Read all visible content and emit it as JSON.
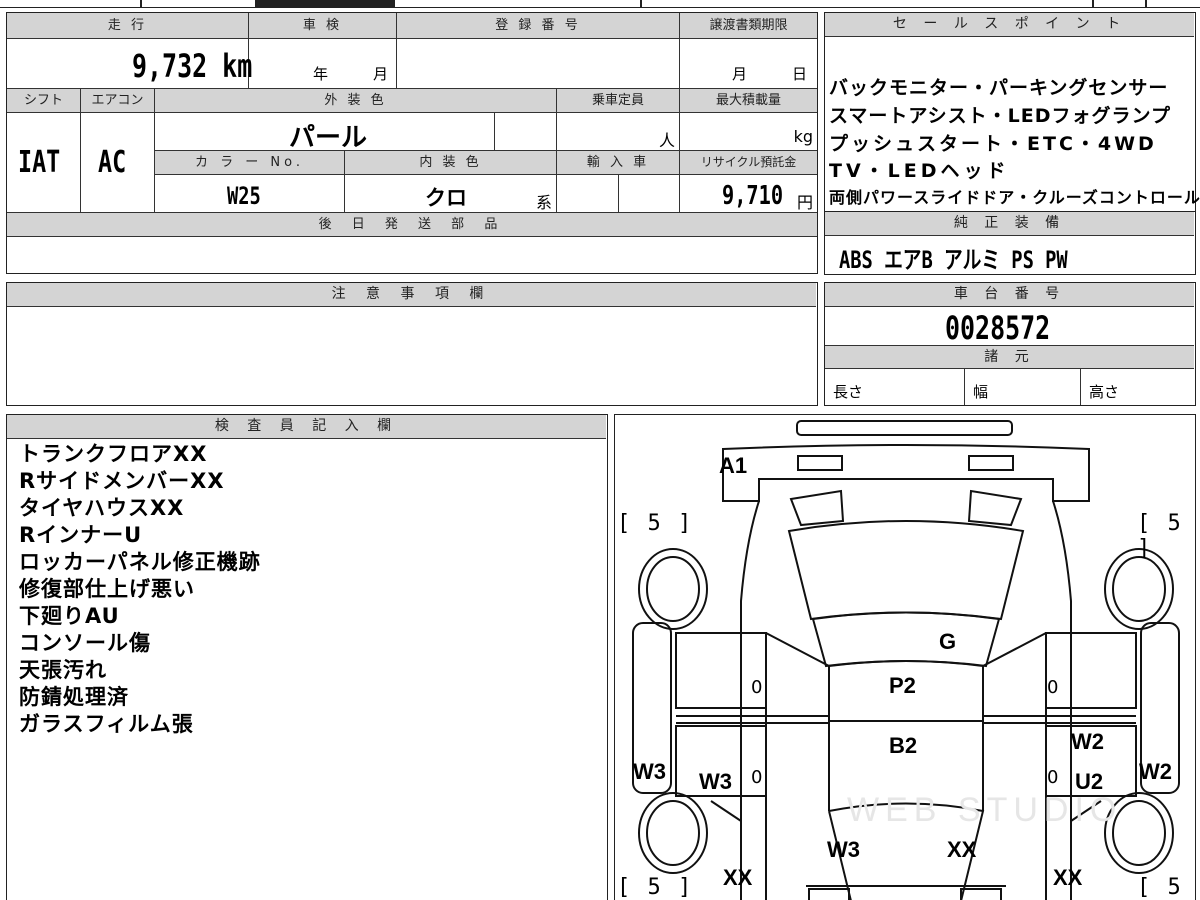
{
  "vehicle": {
    "mileage_label": "走 行",
    "mileage": "9,732 km",
    "inspection_label": "車 検",
    "inspection_year_unit": "年",
    "inspection_month_unit": "月",
    "registration_label": "登 録 番 号",
    "transfer_deadline_label": "譲渡書類期限",
    "transfer_month_unit": "月",
    "transfer_day_unit": "日",
    "shift_label": "シフト",
    "shift": "IAT",
    "ac_label": "エアコン",
    "ac": "AC",
    "exterior_color_label": "外 装 色",
    "exterior_color": "パール",
    "capacity_label": "乗車定員",
    "capacity_unit": "人",
    "max_load_label": "最大積載量",
    "max_load_unit": "kg",
    "color_no_label": "カ ラ ー No.",
    "color_no": "W25",
    "interior_color_label": "内 装 色",
    "interior_color": "クロ",
    "interior_color_suffix": "系",
    "import_label": "輸 入 車",
    "recycle_label": "リサイクル預託金",
    "recycle_fee": "9,710",
    "recycle_unit": "円",
    "later_parts_label": "後 日 発 送 部 品"
  },
  "sales_points": {
    "label": "セ ー ル ス ポ イ ン ト",
    "lines": [
      "バックモニター・パーキングセンサー",
      "スマートアシスト・LEDフォグランプ",
      "プッシュスタート・ETC・4WD",
      "TV・LEDヘッド",
      "両側パワースライドドア・クルーズコントロール"
    ]
  },
  "standard_equipment": {
    "label": "純 正 装 備",
    "items": "ABS エアB アルミ PS PW"
  },
  "notes": {
    "label": "注 意 事 項 欄"
  },
  "chassis": {
    "label": "車 台 番 号",
    "number": "0028572",
    "specs_label": "諸 元",
    "length_label": "長さ",
    "width_label": "幅",
    "height_label": "高さ"
  },
  "inspector": {
    "label": "検 査 員 記 入 欄",
    "lines": [
      "トランクフロアXX",
      "RサイドメンバーXX",
      "タイヤハウスXX",
      "RインナーU",
      "ロッカーパネル修正機跡",
      "修復部仕上げ悪い",
      "下廻りAU",
      "コンソール傷",
      "天張汚れ",
      "防錆処理済",
      "ガラスフィルム張"
    ]
  },
  "diagram": {
    "marks": {
      "a1": "A1",
      "g": "G",
      "p2": "P2",
      "b2": "B2",
      "w3_left_outer": "W3",
      "w3_left_inner": "W3",
      "w2_right_inner": "W2",
      "u2": "U2",
      "w2_right_outer": "W2",
      "w3_bottom": "W3",
      "xx_bottom_center": "XX",
      "xx_bottom_left": "XX",
      "xx_bottom_right": "XX",
      "zero_1": "0",
      "zero_2": "0",
      "zero_3": "0",
      "zero_4": "0"
    },
    "tire_tl": "[ 5 ]",
    "tire_tr": "[ 5 ]",
    "tire_bl": "[ 5 ]",
    "tire_br": "[ 5 ]",
    "watermark": "WEB STUDIO"
  }
}
